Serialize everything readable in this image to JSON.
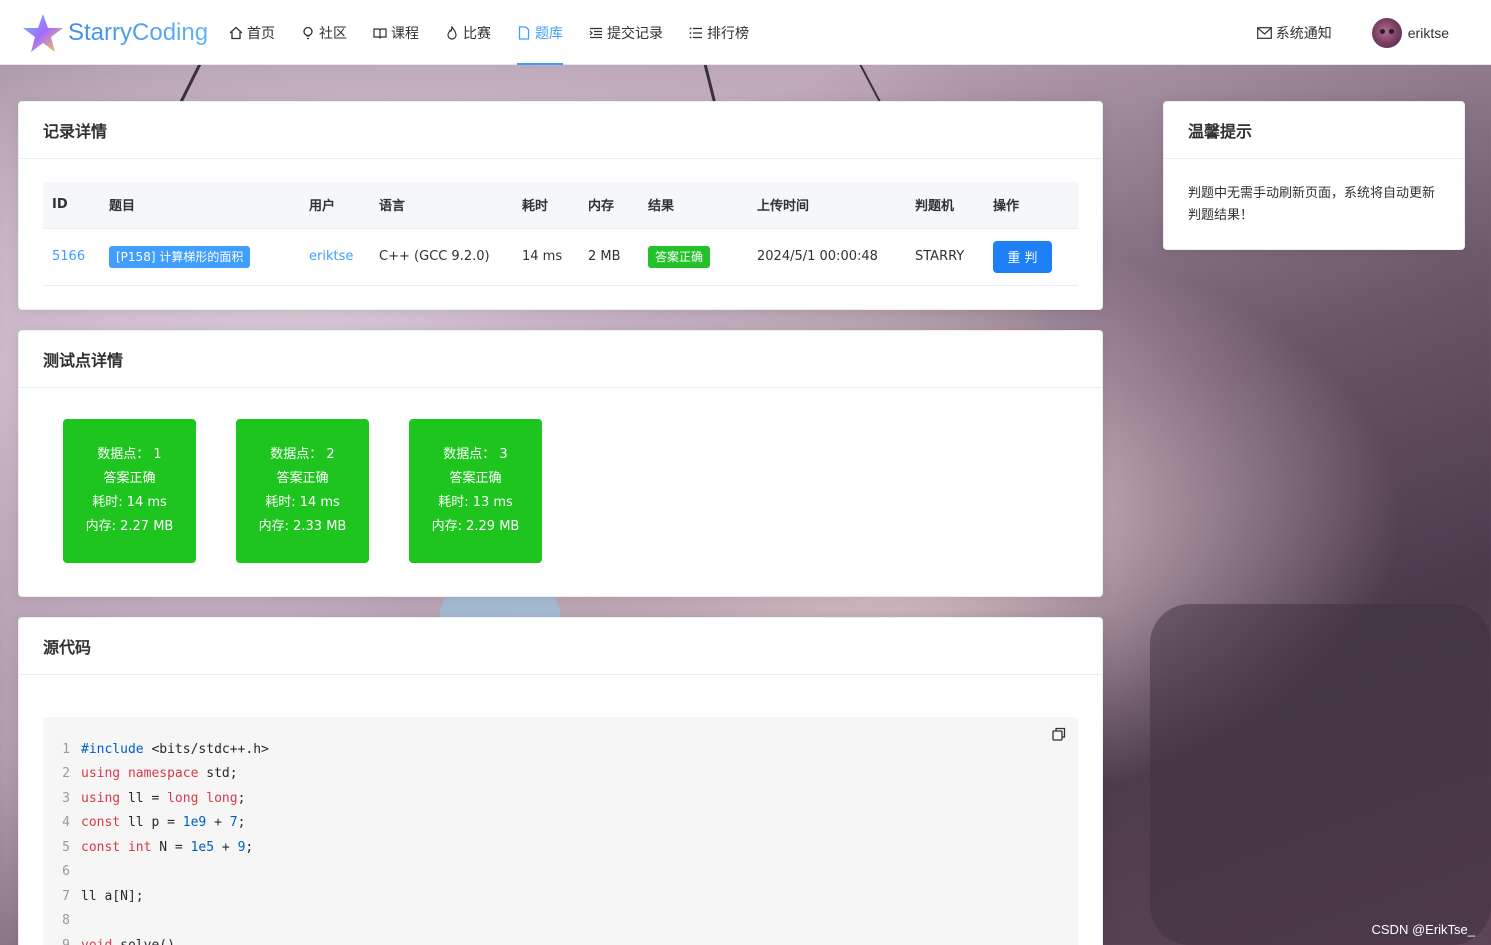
{
  "brand": {
    "name": "StarryCoding"
  },
  "nav": {
    "items": [
      {
        "label": "首页",
        "icon": "home-icon"
      },
      {
        "label": "社区",
        "icon": "bulb-icon"
      },
      {
        "label": "课程",
        "icon": "book-icon"
      },
      {
        "label": "比赛",
        "icon": "flame-icon"
      },
      {
        "label": "题库",
        "icon": "document-icon",
        "active": true
      },
      {
        "label": "提交记录",
        "icon": "list-indent-icon"
      },
      {
        "label": "排行榜",
        "icon": "list-icon"
      }
    ],
    "notice_label": "系统通知",
    "username": "eriktse"
  },
  "record": {
    "title": "记录详情",
    "columns": [
      "ID",
      "题目",
      "用户",
      "语言",
      "耗时",
      "内存",
      "结果",
      "上传时间",
      "判题机",
      "操作"
    ],
    "row": {
      "id": "5166",
      "problem": "[P158] 计算梯形的面积",
      "user": "eriktse",
      "language": "C++ (GCC 9.2.0)",
      "time": "14 ms",
      "memory": "2 MB",
      "result": "答案正确",
      "uploaded": "2024/5/1 00:00:48",
      "judge": "STARRY",
      "action": "重 判"
    }
  },
  "testpoints": {
    "title": "测试点详情",
    "items": [
      {
        "label": "数据点：  1",
        "status": "答案正确",
        "time": "耗时: 14 ms",
        "mem": "内存: 2.27 MB"
      },
      {
        "label": "数据点：  2",
        "status": "答案正确",
        "time": "耗时: 14 ms",
        "mem": "内存: 2.33 MB"
      },
      {
        "label": "数据点：  3",
        "status": "答案正确",
        "time": "耗时: 13 ms",
        "mem": "内存: 2.29 MB"
      }
    ]
  },
  "tips": {
    "title": "温馨提示",
    "text": "判题中无需手动刷新页面，系统将自动更新判题结果！"
  },
  "source": {
    "title": "源代码",
    "lines": [
      {
        "n": "1",
        "parts": [
          [
            "pp",
            "#include"
          ],
          [
            "tx",
            " <bits/stdc++.h>"
          ]
        ]
      },
      {
        "n": "2",
        "parts": [
          [
            "kw",
            "using"
          ],
          [
            "tx",
            " "
          ],
          [
            "kw",
            "namespace"
          ],
          [
            "tx",
            " std;"
          ]
        ]
      },
      {
        "n": "3",
        "parts": [
          [
            "kw",
            "using"
          ],
          [
            "tx",
            " ll = "
          ],
          [
            "kw",
            "long long"
          ],
          [
            "tx",
            ";"
          ]
        ]
      },
      {
        "n": "4",
        "parts": [
          [
            "kw",
            "const"
          ],
          [
            "tx",
            " ll p = "
          ],
          [
            "num",
            "1e9"
          ],
          [
            "tx",
            " + "
          ],
          [
            "num",
            "7"
          ],
          [
            "tx",
            ";"
          ]
        ]
      },
      {
        "n": "5",
        "parts": [
          [
            "kw",
            "const"
          ],
          [
            "tx",
            " "
          ],
          [
            "kw",
            "int"
          ],
          [
            "tx",
            " N = "
          ],
          [
            "num",
            "1e5"
          ],
          [
            "tx",
            " + "
          ],
          [
            "num",
            "9"
          ],
          [
            "tx",
            ";"
          ]
        ]
      },
      {
        "n": "6",
        "parts": []
      },
      {
        "n": "7",
        "parts": [
          [
            "tx",
            "ll a[N];"
          ]
        ]
      },
      {
        "n": "8",
        "parts": []
      },
      {
        "n": "9",
        "parts": [
          [
            "kw",
            "void"
          ],
          [
            "tx",
            " solve()"
          ]
        ]
      }
    ]
  },
  "watermark": "CSDN @ErikTse_"
}
